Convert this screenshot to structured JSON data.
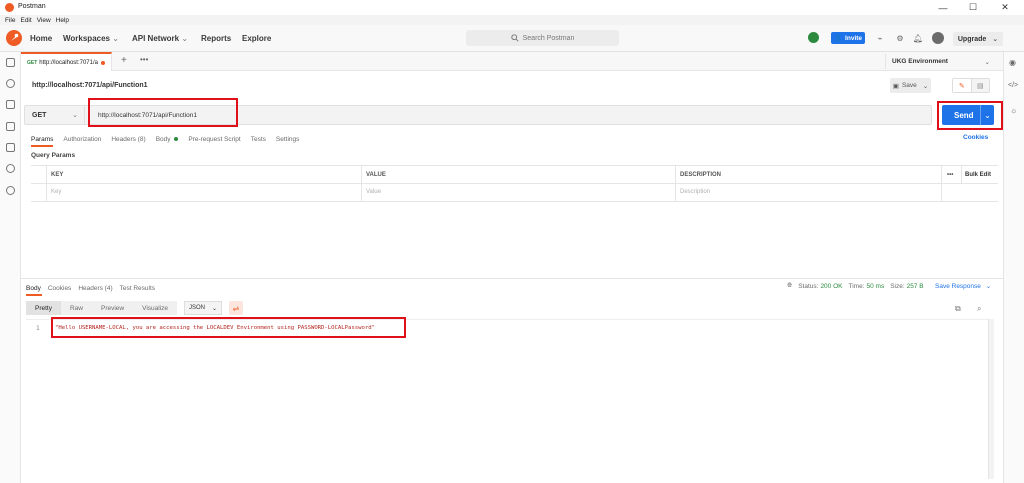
{
  "window": {
    "title": "Postman"
  },
  "menubar": {
    "items": [
      "File",
      "Edit",
      "View",
      "Help"
    ]
  },
  "header": {
    "nav": [
      {
        "label": "Home"
      },
      {
        "label": "Workspaces",
        "chevron": "⌄"
      },
      {
        "label": "API Network",
        "chevron": "⌄"
      },
      {
        "label": "Reports"
      },
      {
        "label": "Explore"
      }
    ],
    "search_placeholder": "Search Postman",
    "invite_label": "Invite",
    "upgrade_label": "Upgrade"
  },
  "tab": {
    "method": "GET",
    "title": "http://localhost:7071/a"
  },
  "environment": {
    "selected": "UKG Environment"
  },
  "request": {
    "name": "http://localhost:7071/api/Function1",
    "save_label": "Save",
    "method": "GET",
    "url": "http://localhost:7071/api/Function1",
    "send_label": "Send"
  },
  "request_tabs": [
    "Params",
    "Authorization",
    "Headers (8)",
    "Body",
    "Pre-request Script",
    "Tests",
    "Settings"
  ],
  "cookies_label": "Cookies",
  "query_params": {
    "title": "Query Params",
    "columns": [
      "KEY",
      "VALUE",
      "DESCRIPTION"
    ],
    "bulk_edit": "Bulk Edit",
    "placeholders": [
      "Key",
      "Value",
      "Description"
    ]
  },
  "response": {
    "tabs": [
      "Body",
      "Cookies",
      "Headers (4)",
      "Test Results"
    ],
    "status_label": "Status:",
    "status_value": "200 OK",
    "time_label": "Time:",
    "time_value": "50 ms",
    "size_label": "Size:",
    "size_value": "257 B",
    "save_response": "Save Response",
    "view_tabs": [
      "Pretty",
      "Raw",
      "Preview",
      "Visualize"
    ],
    "format": "JSON",
    "line_number": "1",
    "body": "\"Hello USERNAME-LOCAL, you are accessing the LOCALDEV Environment using PASSWORD-LOCALPassword\""
  },
  "colors": {
    "brand": "#ef5b25",
    "primary": "#1f73e8",
    "highlight": "#e0101a",
    "success": "#2b8a3e"
  }
}
